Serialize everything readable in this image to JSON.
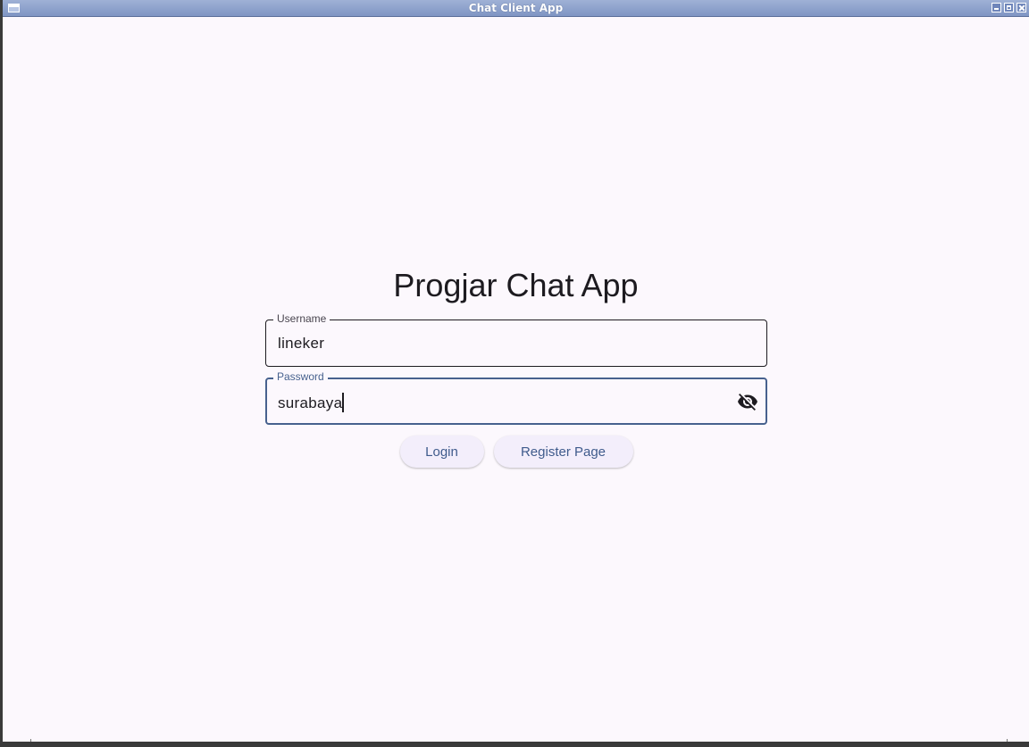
{
  "window": {
    "title": "Chat Client App",
    "controls": [
      "minimize-icon",
      "maximize-icon",
      "close-icon"
    ]
  },
  "app": {
    "title": "Progjar Chat App"
  },
  "form": {
    "username": {
      "label": "Username",
      "value": "lineker"
    },
    "password": {
      "label": "Password",
      "value": "surabaya",
      "visibility_icon": "visibility-off-icon",
      "focused": true
    }
  },
  "buttons": {
    "login_label": "Login",
    "register_label": "Register Page"
  },
  "colors": {
    "background": "#fcf8fd",
    "primary": "#47618e",
    "button_bg": "#f3eefb",
    "titlebar": "#8fa3cd"
  }
}
